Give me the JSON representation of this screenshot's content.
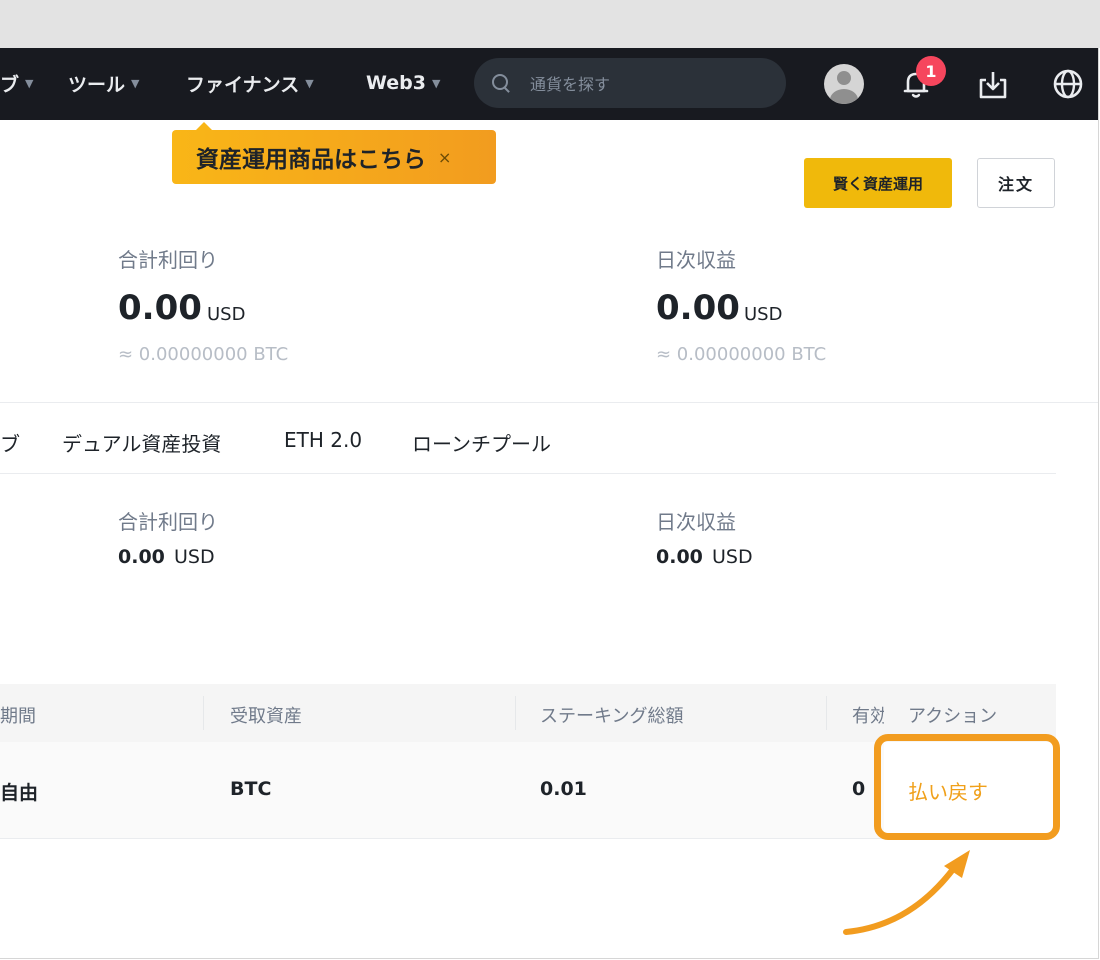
{
  "nav": {
    "items": [
      {
        "label": "ブ"
      },
      {
        "label": "ツール"
      },
      {
        "label": "ファイナンス"
      },
      {
        "label": "Web3"
      }
    ],
    "search_placeholder": "通貨を探す",
    "notification_count": "1",
    "icons": [
      "search-icon",
      "avatar",
      "bell-icon",
      "download-icon",
      "globe-icon"
    ]
  },
  "tooltip": {
    "text": "資産運用商品はこちら",
    "close": "×"
  },
  "header": {
    "primary_button": "賢く資産運用",
    "secondary_button": "注文"
  },
  "summary": {
    "yield_label": "合計利回り",
    "yield_value": "0.00",
    "yield_unit": "USD",
    "yield_btc": "≈ 0.00000000  BTC",
    "daily_label": "日次収益",
    "daily_value": "0.00",
    "daily_unit": "USD",
    "daily_btc": "≈ 0.00000000  BTC"
  },
  "tabs": [
    "ブ",
    "デュアル資産投資",
    "ETH 2.0",
    "ローンチプール"
  ],
  "sub_summary": {
    "yield_label": "合計利回り",
    "yield_value": "0.00",
    "yield_unit": "USD",
    "daily_label": "日次収益",
    "daily_value": "0.00",
    "daily_unit": "USD"
  },
  "table": {
    "headers": [
      "期間",
      "受取資産",
      "ステーキング総額",
      "有効",
      "アクション"
    ],
    "row": {
      "period": "自由",
      "asset": "BTC",
      "amount": "0.01",
      "effective": "0",
      "action": "払い戻す"
    }
  },
  "colors": {
    "accent": "#f0b90b",
    "highlight": "#f29c1f",
    "nav_bg": "#181a20",
    "badge": "#f6465d"
  }
}
